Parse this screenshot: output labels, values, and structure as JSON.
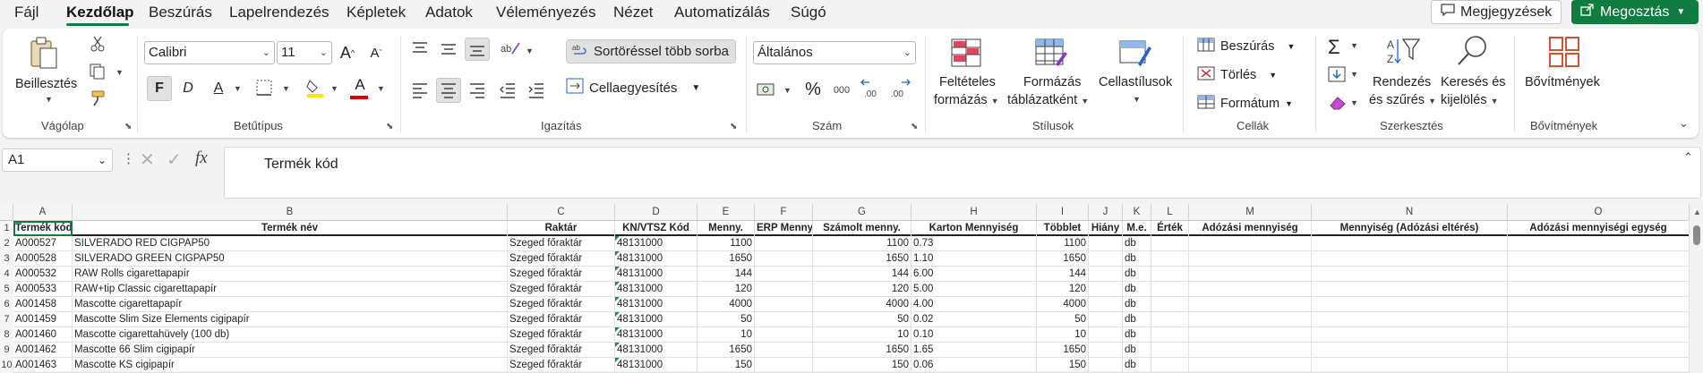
{
  "menu": {
    "tabs": [
      "Fájl",
      "Kezdőlap",
      "Beszúrás",
      "Lapelrendezés",
      "Képletek",
      "Adatok",
      "Véleményezés",
      "Nézet",
      "Automatizálás",
      "Súgó"
    ],
    "comments_label": "Megjegyzések",
    "share_label": "Megosztás"
  },
  "ribbon": {
    "clipboard": {
      "paste_label": "Beillesztés",
      "group": "Vágólap"
    },
    "font": {
      "name": "Calibri",
      "size": "11",
      "bold": "F",
      "italic": "D",
      "underline": "A",
      "color_letter": "A",
      "grow": "A",
      "shrink": "A",
      "group": "Betűtípus"
    },
    "alignment": {
      "wrap_label": "Sortöréssel több sorba",
      "merge_label": "Cellaegyesítés",
      "group": "Igazítás"
    },
    "number": {
      "format": "Általános",
      "percent": "%",
      "thousands": "000",
      "group": "Szám"
    },
    "styles": {
      "cond_label_1": "Feltételes",
      "cond_label_2": "formázás",
      "table_label_1": "Formázás",
      "table_label_2": "táblázatként",
      "cell_styles_label": "Cellastílusok",
      "group": "Stílusok"
    },
    "cells": {
      "insert_label": "Beszúrás",
      "delete_label": "Törlés",
      "format_label": "Formátum",
      "group": "Cellák"
    },
    "editing": {
      "sort_label_1": "Rendezés",
      "sort_label_2": "és szűrés",
      "find_label_1": "Keresés és",
      "find_label_2": "kijelölés",
      "group": "Szerkesztés"
    },
    "addins": {
      "label": "Bővítmények",
      "group": "Bővítmények"
    }
  },
  "formula_bar": {
    "name_box": "A1",
    "fx": "fx",
    "content": "Termék kód"
  },
  "grid": {
    "columns": [
      "A",
      "B",
      "C",
      "D",
      "E",
      "F",
      "G",
      "H",
      "I",
      "J",
      "K",
      "L",
      "M",
      "N",
      "O"
    ],
    "row_numbers": [
      "1",
      "2",
      "3",
      "4",
      "5",
      "6",
      "7",
      "8",
      "9",
      "10"
    ],
    "header": [
      "Termék kód",
      "Termék név",
      "Raktár",
      "KN/VTSZ Kód",
      "Menny.",
      "ERP Menny.",
      "Számolt menny.",
      "Karton Mennyiség",
      "Többlet",
      "Hiány",
      "M.e.",
      "Érték",
      "Adózási mennyiség",
      "Mennyiség (Adózási eltérés)",
      "Adózási mennyiségi egység"
    ],
    "rows": [
      [
        "A000527",
        "SILVERADO RED CIGPAP50",
        "Szeged főraktár",
        "48131000",
        "1100",
        "",
        "1100",
        "0.73",
        "1100",
        "",
        "db",
        "",
        "",
        "",
        ""
      ],
      [
        "A000528",
        "SILVERADO GREEN CIGPAP50",
        "Szeged főraktár",
        "48131000",
        "1650",
        "",
        "1650",
        "1.10",
        "1650",
        "",
        "db",
        "",
        "",
        "",
        ""
      ],
      [
        "A000532",
        "RAW Rolls cigarettapapír",
        "Szeged főraktár",
        "48131000",
        "144",
        "",
        "144",
        "6.00",
        "144",
        "",
        "db",
        "",
        "",
        "",
        ""
      ],
      [
        "A000533",
        "RAW+tip Classic cigarettapapír",
        "Szeged főraktár",
        "48131000",
        "120",
        "",
        "120",
        "5.00",
        "120",
        "",
        "db",
        "",
        "",
        "",
        ""
      ],
      [
        "A001458",
        "Mascotte cigarettapapír",
        "Szeged főraktár",
        "48131000",
        "4000",
        "",
        "4000",
        "4.00",
        "4000",
        "",
        "db",
        "",
        "",
        "",
        ""
      ],
      [
        "A001459",
        "Mascotte Slim Size Elements cigipapír",
        "Szeged főraktár",
        "48131000",
        "50",
        "",
        "50",
        "0.02",
        "50",
        "",
        "db",
        "",
        "",
        "",
        ""
      ],
      [
        "A001460",
        "Mascotte cigarettahüvely (100 db)",
        "Szeged főraktár",
        "48131000",
        "10",
        "",
        "10",
        "0.10",
        "10",
        "",
        "db",
        "",
        "",
        "",
        ""
      ],
      [
        "A001462",
        "Mascotte 66 Slim cigipapír",
        "Szeged főraktár",
        "48131000",
        "1650",
        "",
        "1650",
        "1.65",
        "1650",
        "",
        "db",
        "",
        "",
        "",
        ""
      ],
      [
        "A001463",
        "Mascotte KS cigipapír",
        "Szeged főraktár",
        "48131000",
        "150",
        "",
        "150",
        "0.06",
        "150",
        "",
        "db",
        "",
        "",
        "",
        ""
      ]
    ]
  }
}
